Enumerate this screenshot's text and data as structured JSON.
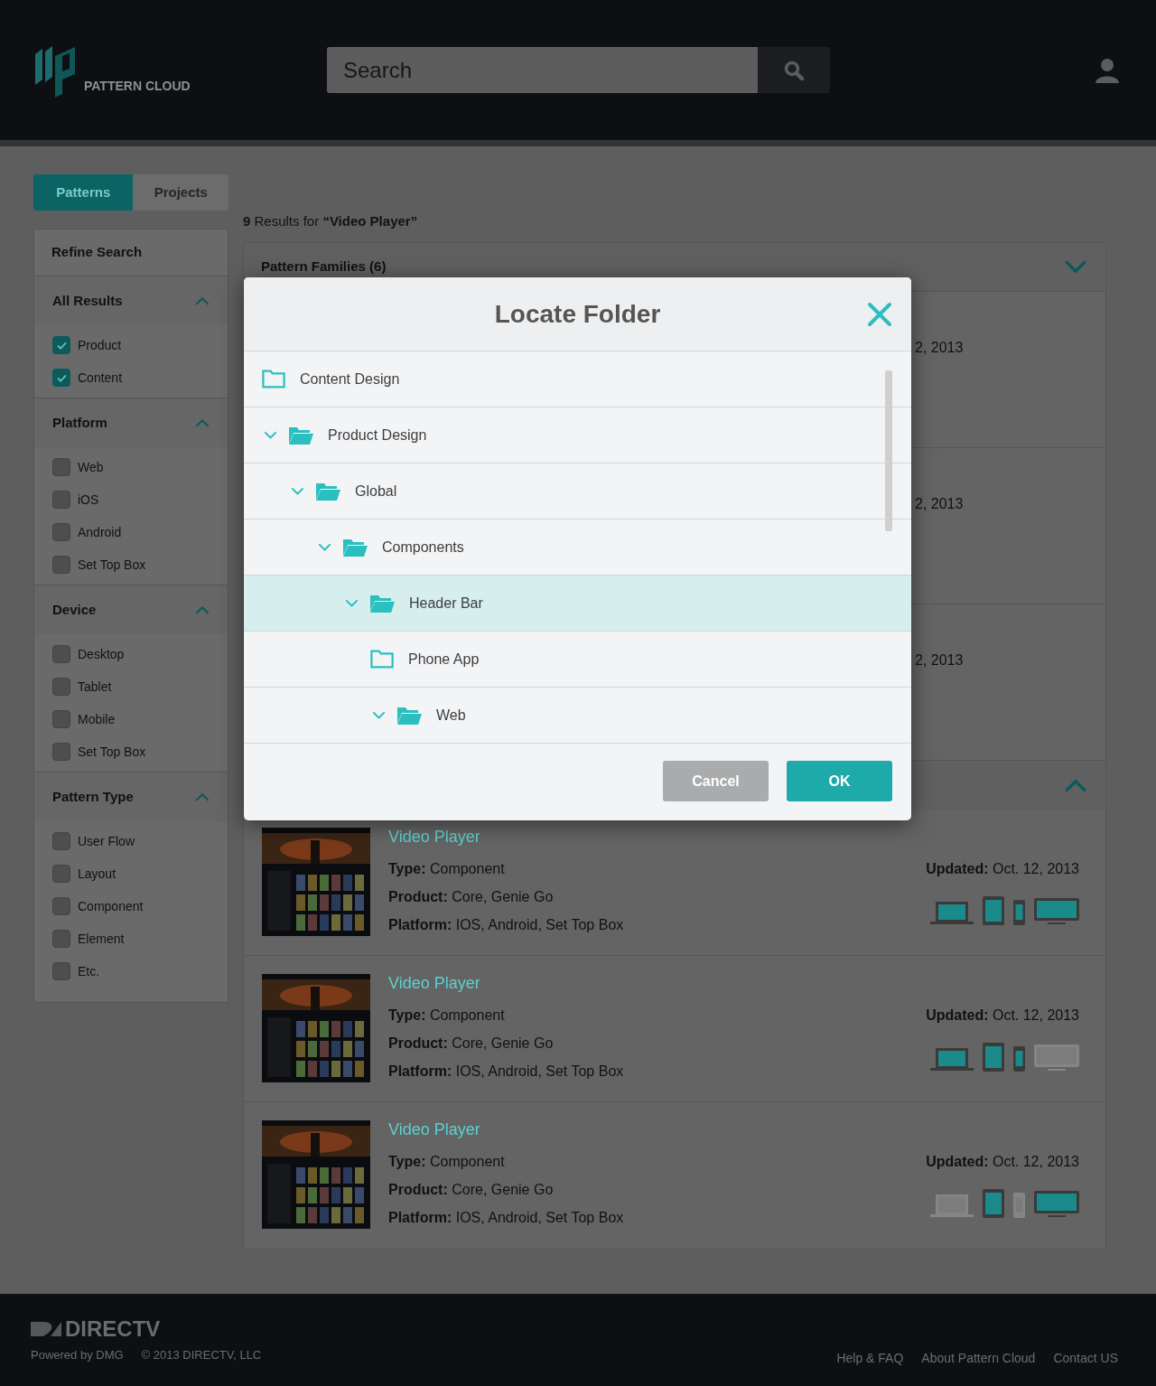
{
  "header": {
    "logo_text": "PATTERN CLOUD",
    "search": {
      "placeholder": "Search"
    }
  },
  "tabs": [
    {
      "label": "Patterns",
      "selected": true
    },
    {
      "label": "Projects",
      "selected": false
    }
  ],
  "results_summary": "**9** Results for **“Video Player”**",
  "sidebar": {
    "title": "Refine Search",
    "sections": [
      {
        "title": "All Results",
        "expanded": true,
        "options": [
          {
            "label": "Product",
            "checked": true
          },
          {
            "label": "Content",
            "checked": true
          }
        ]
      },
      {
        "title": "Platform",
        "expanded": true,
        "options": [
          {
            "label": "Web",
            "checked": false
          },
          {
            "label": "iOS",
            "checked": false
          },
          {
            "label": "Android",
            "checked": false
          },
          {
            "label": "Set Top Box",
            "checked": false
          }
        ]
      },
      {
        "title": "Device",
        "expanded": true,
        "options": [
          {
            "label": "Desktop",
            "checked": false
          },
          {
            "label": "Tablet",
            "checked": false
          },
          {
            "label": "Mobile",
            "checked": false
          },
          {
            "label": "Set Top Box",
            "checked": false
          }
        ]
      },
      {
        "title": "Pattern Type",
        "expanded": true,
        "options": [
          {
            "label": "User Flow",
            "checked": false
          },
          {
            "label": "Layout",
            "checked": false
          },
          {
            "label": "Component",
            "checked": false
          },
          {
            "label": "Element",
            "checked": false
          },
          {
            "label": "Etc.",
            "checked": false
          }
        ]
      }
    ]
  },
  "pattern_families": {
    "title": "Pattern Families (6)",
    "expanded": false,
    "partial_dates": [
      "2, 2013",
      "2, 2013",
      "2, 2013"
    ]
  },
  "second_group": {
    "expanded": true,
    "results": [
      {
        "title": "Video Player",
        "type": "**Type:** Component",
        "product": "**Product:** Core, Genie Go",
        "platform": "**Platform:** IOS, Android, Set Top Box",
        "updated": "**Updated:** Oct. 12, 2013",
        "devices": [
          {
            "kind": "laptop",
            "on": true
          },
          {
            "kind": "tablet",
            "on": true
          },
          {
            "kind": "phone",
            "on": true
          },
          {
            "kind": "monitor",
            "on": true
          }
        ]
      },
      {
        "title": "Video Player",
        "type": "**Type:** Component",
        "product": "**Product:** Core, Genie Go",
        "platform": "**Platform:** IOS, Android, Set Top Box",
        "updated": "**Updated:** Oct. 12, 2013",
        "devices": [
          {
            "kind": "laptop",
            "on": true
          },
          {
            "kind": "tablet",
            "on": true
          },
          {
            "kind": "phone",
            "on": true
          },
          {
            "kind": "monitor",
            "on": false
          }
        ]
      },
      {
        "title": "Video Player",
        "type": "**Type:** Component",
        "product": "**Product:** Core, Genie Go",
        "platform": "**Platform:** IOS, Android, Set Top Box",
        "updated": "**Updated:** Oct. 12, 2013",
        "devices": [
          {
            "kind": "laptop",
            "on": false
          },
          {
            "kind": "tablet",
            "on": true
          },
          {
            "kind": "phone",
            "on": false
          },
          {
            "kind": "monitor",
            "on": true
          }
        ]
      }
    ]
  },
  "dialog": {
    "title": "Locate Folder",
    "folders": [
      {
        "name": "Content Design",
        "expanded": false,
        "selected": false
      },
      {
        "name": "Product Design",
        "expanded": true,
        "selected": false,
        "children": [
          {
            "name": "Global",
            "expanded": true,
            "selected": false,
            "children": [
              {
                "name": "Components",
                "expanded": true,
                "selected": false,
                "children": [
                  {
                    "name": "Header Bar",
                    "expanded": true,
                    "selected": true,
                    "children": [
                      {
                        "name": "Phone App",
                        "expanded": false,
                        "selected": false
                      },
                      {
                        "name": "Web",
                        "expanded": true,
                        "selected": false
                      }
                    ]
                  }
                ]
              }
            ]
          }
        ]
      }
    ],
    "buttons": [
      "Cancel",
      "OK"
    ]
  },
  "footer": {
    "brand": "DIRECTV",
    "powered_by": "Powered by DMG",
    "copyright": "© 2013 DIRECTV, LLC",
    "links": [
      "Help & FAQ",
      "About Pattern Cloud",
      "Contact US"
    ]
  }
}
